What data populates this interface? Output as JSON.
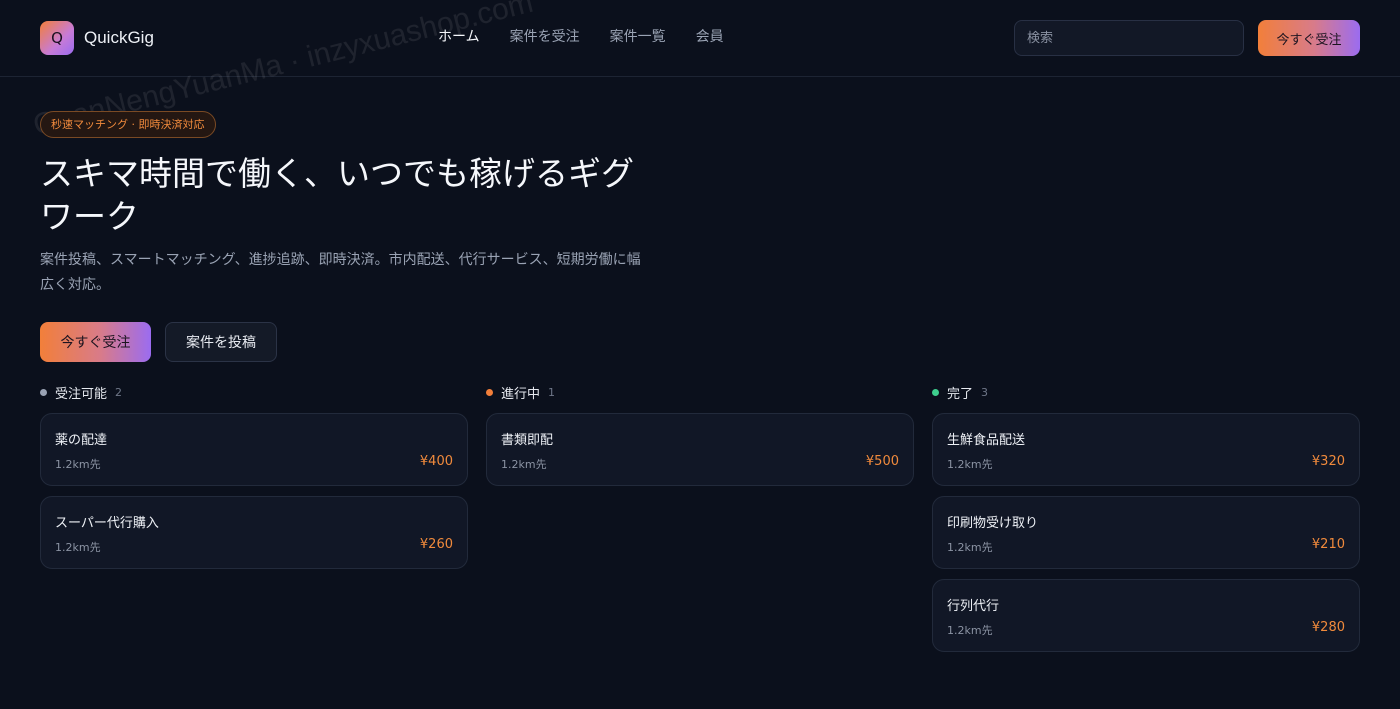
{
  "header": {
    "logo_letter": "Q",
    "brand": "QuickGig",
    "nav": [
      {
        "label": "ホーム",
        "active": true
      },
      {
        "label": "案件を受注",
        "active": false
      },
      {
        "label": "案件一覧",
        "active": false
      },
      {
        "label": "会員",
        "active": false
      }
    ],
    "search_placeholder": "検索",
    "cta_label": "今すぐ受注"
  },
  "hero": {
    "badge": "秒速マッチング · 即時決済対応",
    "title": "スキマ時間で働く、いつでも稼げるギグワーク",
    "description": "案件投稿、スマートマッチング、進捗追跡、即時決済。市内配送、代行サービス、短期労働に幅広く対応。",
    "primary_button": "今すぐ受注",
    "secondary_button": "案件を投稿"
  },
  "columns": [
    {
      "label": "受注可能",
      "count": "2",
      "dot_color": "#9aa3b4",
      "cards": [
        {
          "title": "薬の配達",
          "distance": "1.2km先",
          "price": "¥400"
        },
        {
          "title": "スーパー代行購入",
          "distance": "1.2km先",
          "price": "¥260"
        }
      ]
    },
    {
      "label": "進行中",
      "count": "1",
      "dot_color": "#f27f3a",
      "cards": [
        {
          "title": "書類即配",
          "distance": "1.2km先",
          "price": "¥500"
        }
      ]
    },
    {
      "label": "完了",
      "count": "3",
      "dot_color": "#3ecf8e",
      "cards": [
        {
          "title": "生鮮食品配送",
          "distance": "1.2km先",
          "price": "¥320"
        },
        {
          "title": "印刷物受け取り",
          "distance": "1.2km先",
          "price": "¥210"
        },
        {
          "title": "行列代行",
          "distance": "1.2km先",
          "price": "¥280"
        }
      ]
    }
  ],
  "watermark": "QuanNengYuanMa · inzyxuashop.com",
  "colors": {
    "accent": "#f27f3a",
    "accent_end": "#9b6cf0",
    "background": "#0b101c"
  }
}
